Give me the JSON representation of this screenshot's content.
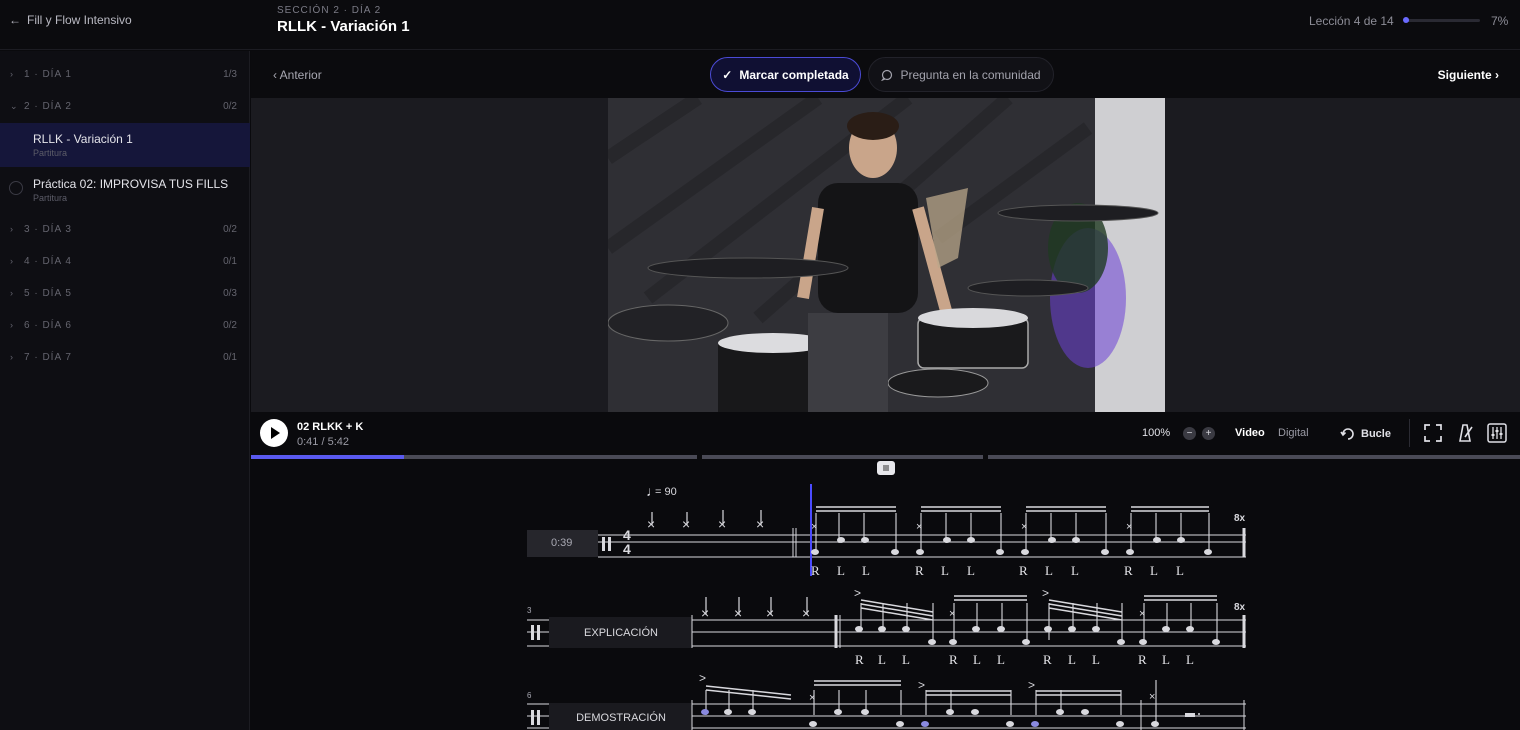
{
  "header": {
    "back_label": "Fill y Flow Intensivo",
    "section_label": "SECCIÓN 2 · DÍA 2",
    "lesson_title": "RLLK - Variación 1",
    "progress_text": "Lección 4 de 14",
    "progress_percent_label": "7%",
    "progress_fraction": 0.07
  },
  "sidebar": {
    "days": [
      {
        "chevron": "›",
        "label": "1 · DÍA 1",
        "count": "1/3"
      },
      {
        "chevron": "⌄",
        "label": "2 · DÍA 2",
        "count": "0/2"
      },
      {
        "chevron": "›",
        "label": "3 · DÍA 3",
        "count": "0/2"
      },
      {
        "chevron": "›",
        "label": "4 · DÍA 4",
        "count": "0/1"
      },
      {
        "chevron": "›",
        "label": "5 · DÍA 5",
        "count": "0/3"
      },
      {
        "chevron": "›",
        "label": "6 · DÍA 6",
        "count": "0/2"
      },
      {
        "chevron": "›",
        "label": "7 · DÍA 7",
        "count": "0/1"
      }
    ],
    "lessons": [
      {
        "title": "RLLK - Variación 1",
        "subtitle": "Partitura"
      },
      {
        "title": "Práctica 02: IMPROVISA TUS FILLS",
        "subtitle": "Partitura"
      }
    ]
  },
  "nav": {
    "prev_label": "‹ Anterior",
    "complete_label": "Marcar completada",
    "community_label": "Pregunta en la comunidad",
    "next_label": "Siguiente ›"
  },
  "player": {
    "track_name": "02 RLKK + K",
    "time": "0:41 / 5:42",
    "zoom": "100%",
    "minus": "−",
    "plus": "+",
    "mode_video": "Video",
    "mode_digital": "Digital",
    "loop_label": "Bucle",
    "played_fraction": 0.12
  },
  "sheet": {
    "tempo": "= 90",
    "time_marker": "0:39",
    "repeat1": "8x",
    "repeat2": "8x",
    "measure3": "3",
    "measure6": "6",
    "section_expl": "EXPLICACIÓN",
    "section_demo": "DEMOSTRACIÓN",
    "sticking": "R"
  },
  "colors": {
    "accent": "#5a5af0",
    "active_bg": "#15163a"
  }
}
